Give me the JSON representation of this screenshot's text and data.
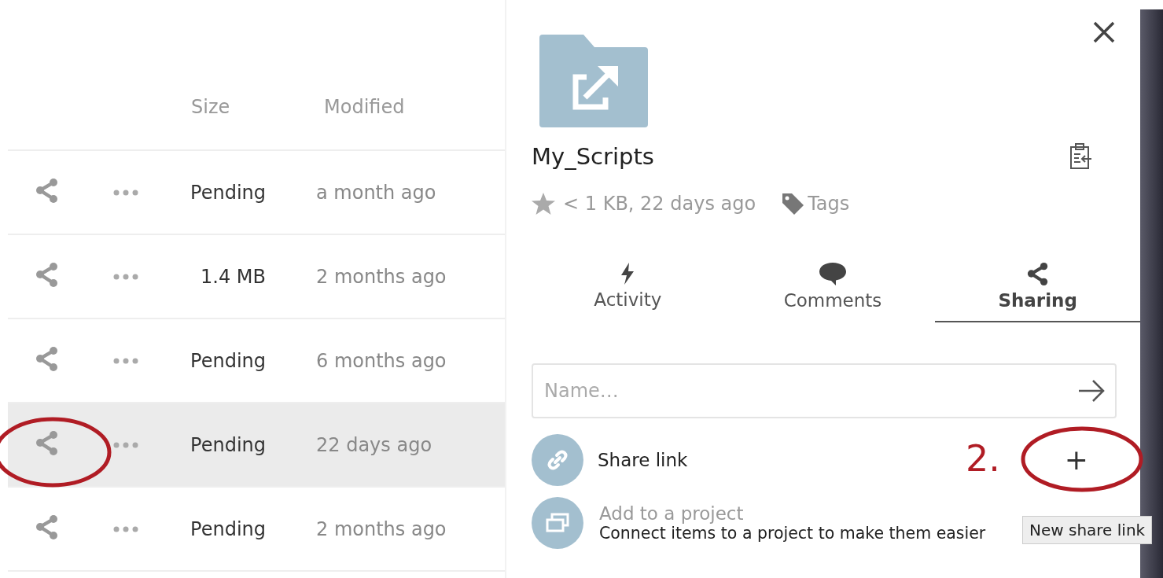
{
  "file_list": {
    "columns": [
      "Size",
      "Modified"
    ],
    "rows": [
      {
        "size": "Pending",
        "modified": "a month ago",
        "selected": false
      },
      {
        "size": "1.4 MB",
        "modified": "2 months ago",
        "selected": false
      },
      {
        "size": "Pending",
        "modified": "6 months ago",
        "selected": false
      },
      {
        "size": "Pending",
        "modified": "22 days ago",
        "selected": true
      },
      {
        "size": "Pending",
        "modified": "2 months ago",
        "selected": false
      }
    ]
  },
  "details": {
    "title": "My_Scripts",
    "meta": "< 1 KB, 22 days ago",
    "tags": "Tags",
    "tabs": [
      {
        "kind": "activity",
        "label": "Activity",
        "selected": false
      },
      {
        "kind": "comments",
        "label": "Comments",
        "selected": false
      },
      {
        "kind": "sharing",
        "label": "Sharing",
        "selected": true
      }
    ],
    "share_input": {
      "placeholder": "Name…"
    },
    "share_link": {
      "label": "Share link",
      "add": "+"
    },
    "project": {
      "title": "Add to a project",
      "description": "Connect items to a project to make them easier"
    },
    "tooltip": "New share link"
  },
  "annotations": [
    {
      "kind": "ellipse"
    },
    {
      "kind": "ellipse"
    },
    {
      "kind": "label",
      "text": "2."
    }
  ]
}
